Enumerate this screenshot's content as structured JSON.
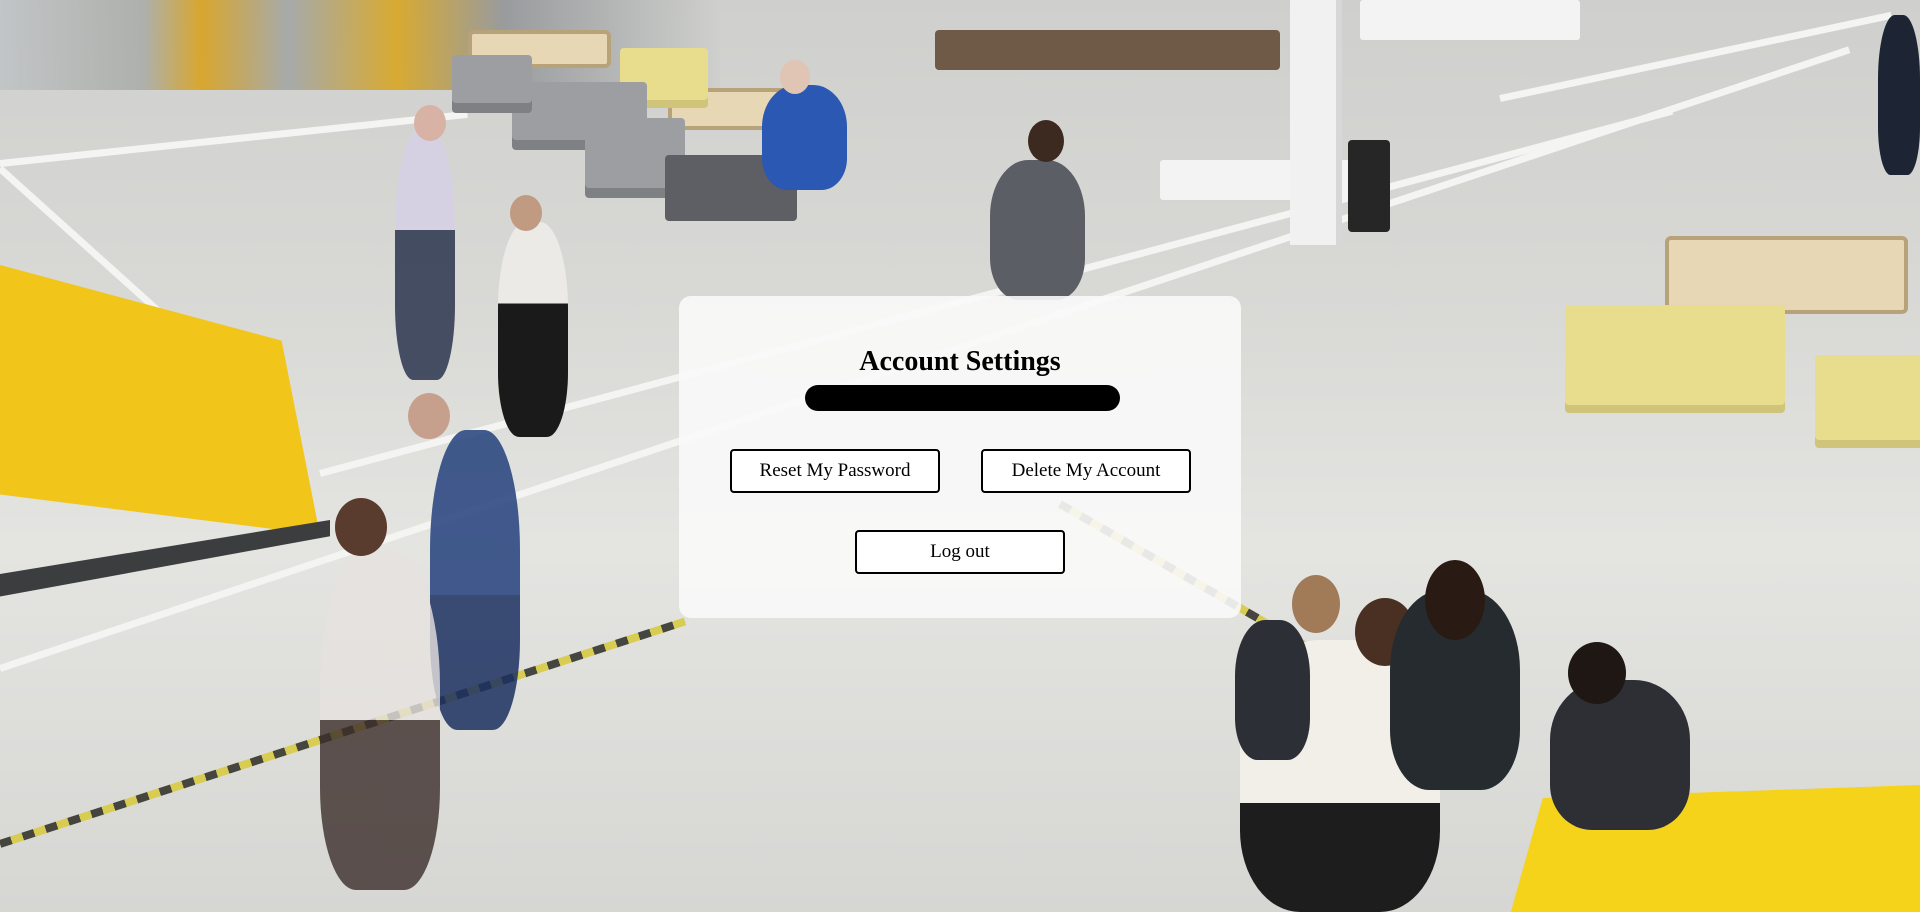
{
  "card": {
    "title": "Account Settings",
    "buttons": {
      "reset_password": "Reset My Password",
      "delete_account": "Delete My Account",
      "logout": "Log out"
    }
  },
  "colors": {
    "card_background": "#fafafa",
    "button_border": "#000000",
    "redaction": "#000000"
  }
}
